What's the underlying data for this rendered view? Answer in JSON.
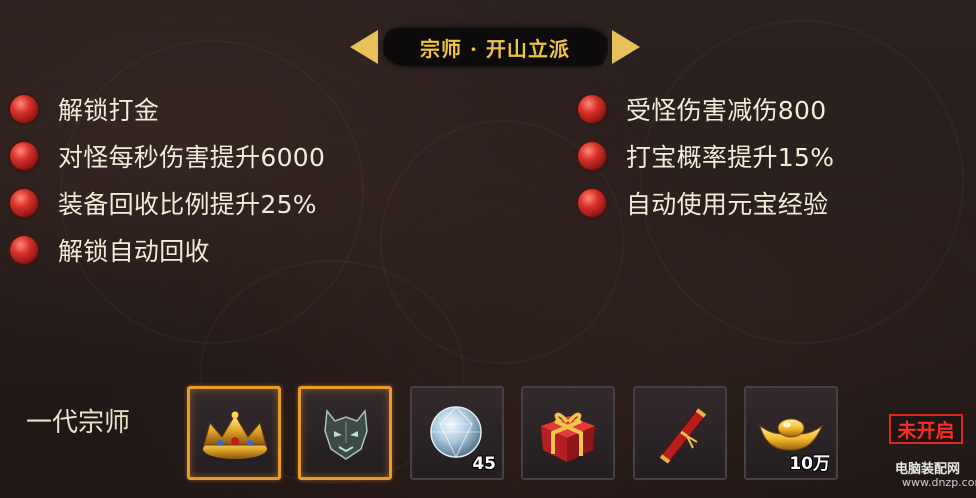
{
  "title": {
    "text": "宗师 · 开山立派"
  },
  "perks_left": [
    {
      "text": "解锁打金"
    },
    {
      "text": "对怪每秒伤害提升6000"
    },
    {
      "text": "装备回收比例提升25%"
    },
    {
      "text": "解锁自动回收"
    }
  ],
  "perks_right": [
    {
      "text": "受怪伤害减伤800"
    },
    {
      "text": "打宝概率提升15%"
    },
    {
      "text": "自动使用元宝经验"
    }
  ],
  "tier": {
    "label": "一代宗师",
    "status": "未开启"
  },
  "rewards": [
    {
      "icon": "crown-icon",
      "quantity": "",
      "frame": "gold"
    },
    {
      "icon": "demon-mask-icon",
      "quantity": "",
      "frame": "gold"
    },
    {
      "icon": "diamond-gem-icon",
      "quantity": "45",
      "frame": "plain"
    },
    {
      "icon": "gift-box-icon",
      "quantity": "",
      "frame": "plain"
    },
    {
      "icon": "scroll-icon",
      "quantity": "",
      "frame": "plain"
    },
    {
      "icon": "gold-ingot-icon",
      "quantity": "10万",
      "frame": "plain"
    }
  ],
  "watermark": {
    "main": "电脑装配网",
    "sub": "www.dnzp.com"
  },
  "colors": {
    "title_gold": "#f0c348",
    "bullet_red": "#d8322a",
    "slot_gold_border": "#e89a2a",
    "status_red": "#e0241e"
  }
}
